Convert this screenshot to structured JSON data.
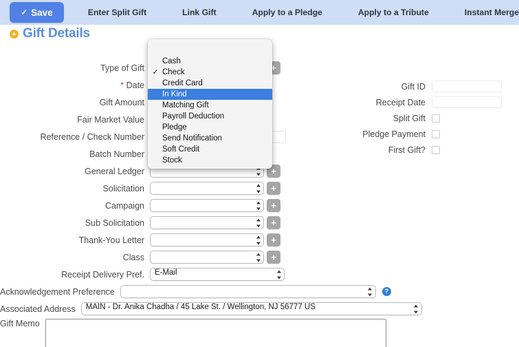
{
  "toolbar": {
    "save_label": "Save",
    "save_icon": "check-icon",
    "save_color": "#5181e6",
    "background": "#cfddf6",
    "nav_items": [
      "Enter Split Gift",
      "Link Gift",
      "Apply to a Pledge",
      "Apply to a Tribute",
      "Instant Merge"
    ]
  },
  "section": {
    "title": "Gift Details",
    "title_color": "#5b8ee0",
    "collapse_icon": "chevron-up-circle-icon",
    "collapse_icon_color": "#f0b429"
  },
  "form": {
    "labels": {
      "type_of_gift": "Type of Gift",
      "date": "Date",
      "date_required_marker": "*",
      "gift_amount": "Gift Amount",
      "fair_market_value": "Fair Market Value",
      "reference_check_number": "Reference / Check Number",
      "batch_number": "Batch Number",
      "general_ledger": "General Ledger",
      "solicitation": "Solicitation",
      "campaign": "Campaign",
      "sub_solicitation": "Sub Solicitation",
      "thank_you_letter": "Thank-You Letter",
      "class": "Class",
      "receipt_delivery_pref": "Receipt Delivery Pref.",
      "acknowledgement_preference": "Acknowledgement Preference",
      "associated_address": "Associated Address",
      "gift_memo": "Gift Memo"
    },
    "values": {
      "type_of_gift": "",
      "date": "",
      "gift_amount": "",
      "fair_market_value": "",
      "reference_check_number": "",
      "batch_number": "",
      "general_ledger": "",
      "solicitation": "",
      "campaign": "",
      "sub_solicitation": "",
      "thank_you_letter": "",
      "class": "",
      "receipt_delivery_pref": "E-Mail",
      "acknowledgement_preference": "",
      "associated_address": "MAIN - Dr. Anika Chadha / 45 Lake St. / Wellington, NJ 56777 US",
      "gift_memo": ""
    },
    "add_button_label": "+",
    "add_button_icon": "plus-icon",
    "help_icon": "question-mark-circle-icon",
    "help_icon_color": "#2f7fd6"
  },
  "right_column": {
    "gift_id_label": "Gift ID",
    "gift_id_value": "",
    "receipt_date_label": "Receipt Date",
    "receipt_date_value": "",
    "split_gift_label": "Split Gift",
    "split_gift_checked": false,
    "pledge_payment_label": "Pledge Payment",
    "pledge_payment_checked": false,
    "first_gift_label": "First Gift?",
    "first_gift_checked": false
  },
  "dropdown": {
    "open": true,
    "checked_option": "Check",
    "highlighted_option": "In Kind",
    "highlight_color": "#3b7fe0",
    "check_glyph": "✓",
    "options": [
      "Cash",
      "Check",
      "Credit Card",
      "In Kind",
      "Matching Gift",
      "Payroll Deduction",
      "Pledge",
      "Send Notification",
      "Soft Credit",
      "Stock"
    ]
  }
}
